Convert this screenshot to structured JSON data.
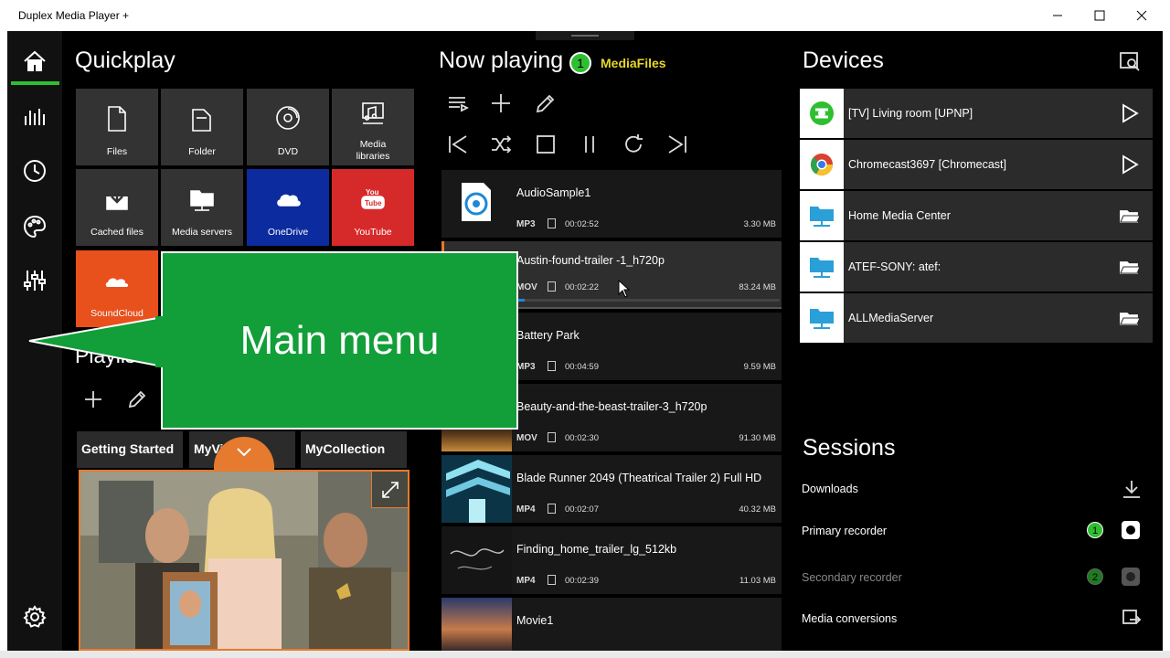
{
  "window": {
    "title": "Duplex Media Player +",
    "minimize_icon": "minimize-icon",
    "maximize_icon": "maximize-icon",
    "close_icon": "close-icon"
  },
  "rail": {
    "items": [
      {
        "icon": "home-icon"
      },
      {
        "icon": "equalizer-bars-icon"
      },
      {
        "icon": "history-icon"
      },
      {
        "icon": "palette-icon"
      },
      {
        "icon": "mixer-sliders-icon"
      },
      {
        "icon": "gear-icon"
      }
    ],
    "accent": "#2ebf30"
  },
  "quickplay": {
    "title": "Quickplay",
    "tiles": [
      {
        "label": "Files",
        "icon": "file-icon",
        "color": "#333333"
      },
      {
        "label": "Folder",
        "icon": "folder-icon",
        "color": "#333333"
      },
      {
        "label": "DVD",
        "icon": "disc-icon",
        "color": "#333333"
      },
      {
        "label": "Media\nlibraries",
        "icon": "media-library-icon",
        "color": "#333333"
      },
      {
        "label": "Cached files",
        "icon": "download-box-icon",
        "color": "#333333"
      },
      {
        "label": "Media servers",
        "icon": "server-folder-icon",
        "color": "#333333"
      },
      {
        "label": "OneDrive",
        "icon": "cloud-icon",
        "color": "#0c2b9e"
      },
      {
        "label": "YouTube",
        "icon": "youtube-icon",
        "color": "#d62a2a"
      },
      {
        "label": "SoundCloud",
        "icon": "soundcloud-icon",
        "color": "#e8501c"
      }
    ]
  },
  "playlists": {
    "title": "Playlists",
    "add_icon": "plus-icon",
    "edit_icon": "pencil-icon",
    "tabs": [
      {
        "label": "Getting Started"
      },
      {
        "label": "MyVi"
      },
      {
        "label": "MyCollection"
      }
    ],
    "expand_icon": "expand-arrows-icon",
    "collapse_icon": "chevron-down-icon"
  },
  "now_playing": {
    "title": "Now playing",
    "badge": "1",
    "source": "MediaFiles",
    "toolbar": [
      {
        "icon": "playlist-icon"
      },
      {
        "icon": "plus-icon"
      },
      {
        "icon": "pencil-icon"
      }
    ],
    "controls": [
      {
        "icon": "skip-previous-icon"
      },
      {
        "icon": "shuffle-icon"
      },
      {
        "icon": "stop-icon"
      },
      {
        "icon": "pause-icon"
      },
      {
        "icon": "repeat-icon"
      },
      {
        "icon": "skip-next-icon"
      }
    ],
    "items": [
      {
        "title": "AudioSample1",
        "type": "MP3",
        "duration": "00:02:52",
        "size": "3.30 MB"
      },
      {
        "title": "Austin-found-trailer -1_h720p",
        "type": "MOV",
        "duration": "00:02:22",
        "size": "83.24 MB",
        "active": true,
        "progress": 0.03
      },
      {
        "title": "Battery Park",
        "type": "MP3",
        "duration": "00:04:59",
        "size": "9.59 MB"
      },
      {
        "title": "Beauty-and-the-beast-trailer-3_h720p",
        "type": "MOV",
        "duration": "00:02:30",
        "size": "91.30 MB"
      },
      {
        "title": "Blade Runner 2049 (Theatrical Trailer 2) Full HD",
        "type": "MP4",
        "duration": "00:02:07",
        "size": "40.32 MB"
      },
      {
        "title": "Finding_home_trailer_lg_512kb",
        "type": "MP4",
        "duration": "00:02:39",
        "size": "11.03 MB"
      },
      {
        "title": "Movie1",
        "type": "",
        "duration": "",
        "size": ""
      }
    ]
  },
  "devices": {
    "title": "Devices",
    "search_icon": "search-device-icon",
    "items": [
      {
        "label": "[TV] Living room [UPNP]",
        "icon": "upnp-icon",
        "action": "play-icon"
      },
      {
        "label": "Chromecast3697 [Chromecast]",
        "icon": "chrome-icon",
        "action": "play-icon"
      },
      {
        "label": "Home Media Center",
        "icon": "network-folder-icon",
        "action": "open-folder-icon"
      },
      {
        "label": "ATEF-SONY: atef:",
        "icon": "network-folder-icon",
        "action": "open-folder-icon"
      },
      {
        "label": "ALLMediaServer",
        "icon": "network-folder-icon",
        "action": "open-folder-icon"
      }
    ]
  },
  "sessions": {
    "title": "Sessions",
    "items": [
      {
        "label": "Downloads",
        "icon": "download-icon"
      },
      {
        "label": "Primary recorder",
        "badge": "1",
        "icon": "record-icon"
      },
      {
        "label": "Secondary recorder",
        "badge": "2",
        "icon": "record-icon",
        "disabled": true
      },
      {
        "label": "Media conversions",
        "icon": "convert-icon"
      }
    ]
  },
  "callout": {
    "text": "Main menu",
    "color": "#129e38"
  }
}
